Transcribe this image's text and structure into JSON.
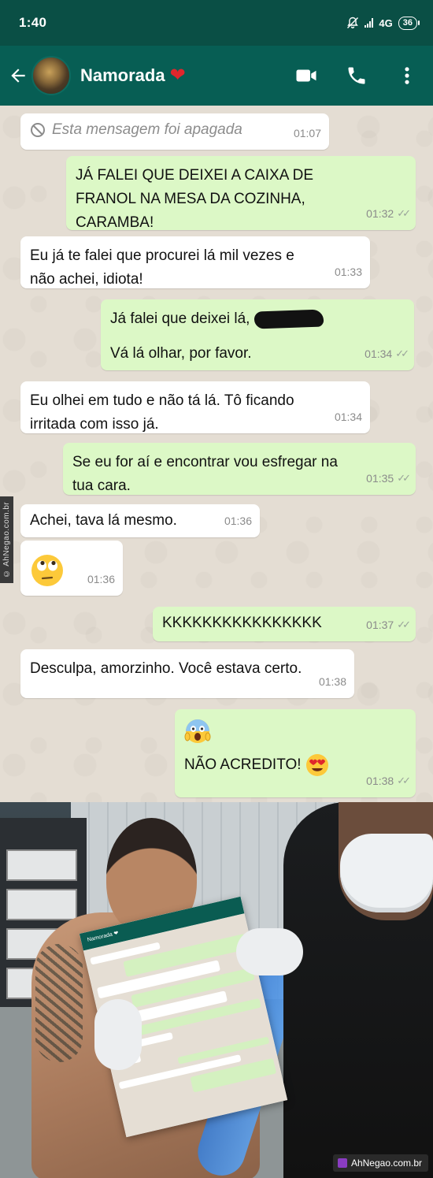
{
  "status_bar": {
    "time": "1:40",
    "network": "4G",
    "battery": "36"
  },
  "header": {
    "contact_name": "Namorada",
    "contact_emoji": "❤",
    "icons": [
      "back-arrow-icon",
      "video-call-icon",
      "phone-icon",
      "more-vert-icon"
    ]
  },
  "messages": [
    {
      "dir": "in",
      "deleted": true,
      "text": "Esta mensagem foi apagada",
      "time": "01:07"
    },
    {
      "dir": "out",
      "lines": [
        "JÁ FALEI QUE DEIXEI A CAIXA DE",
        "FRANOL NA MESA DA COZINHA,",
        "CARAMBA!"
      ],
      "time": "01:32",
      "ticks": "✓✓"
    },
    {
      "dir": "in",
      "lines": [
        "Eu já te falei que procurei lá mil vezes e",
        "não achei, idiota!"
      ],
      "time": "01:33"
    },
    {
      "dir": "out",
      "lines": [
        "Já falei que deixei lá,",
        "Vá lá olhar, por favor."
      ],
      "time": "01:34",
      "ticks": "✓✓"
    },
    {
      "dir": "in",
      "lines": [
        "Eu olhei em tudo e não tá lá. Tô ficando",
        "irritada com isso já."
      ],
      "time": "01:34"
    },
    {
      "dir": "out",
      "lines": [
        "Se eu for aí e encontrar vou esfregar na",
        "tua cara."
      ],
      "time": "01:35",
      "ticks": "✓✓"
    },
    {
      "dir": "in",
      "lines": [
        "Achei, tava lá mesmo."
      ],
      "time": "01:36"
    },
    {
      "dir": "in",
      "emoji": "rolling-eyes-emoji",
      "time": "01:36"
    },
    {
      "dir": "out",
      "lines": [
        "KKKKKKKKKKKKKKKK"
      ],
      "time": "01:37",
      "ticks": "✓✓"
    },
    {
      "dir": "in",
      "lines": [
        "Desculpa, amorzinho. Você estava certo."
      ],
      "time": "01:38"
    },
    {
      "dir": "out",
      "emoji": "screaming-face-emoji",
      "lines": [
        "NÃO ACREDITO!"
      ],
      "trailing_emoji": "heart-eyes-emoji",
      "time": "01:38",
      "ticks": "✓✓"
    }
  ],
  "side_watermark": "© AhNegao.com.br",
  "photo": {
    "paper_header": "Namorada ❤",
    "site_badge": "AhNegao.com.br"
  },
  "colors": {
    "header": "#075e54",
    "status_bar": "#0a4f45",
    "bubble_out": "#dcf8c6",
    "bubble_in": "#ffffff",
    "chat_bg": "#e4ddd3"
  }
}
